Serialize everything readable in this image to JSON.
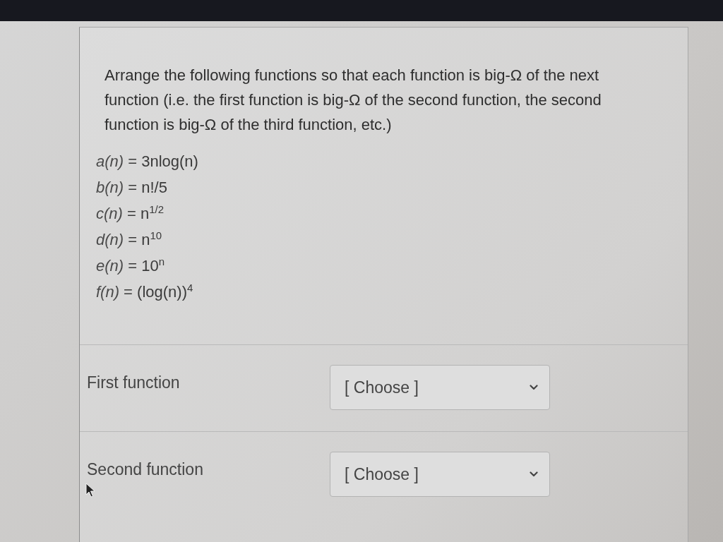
{
  "question": {
    "prompt": "Arrange the following functions so that each function is big-Ω of the next function (i.e. the first function is big-Ω of the second function, the second function is big-Ω of the third function, etc.)",
    "functions": [
      "*a(n)* = 3nlog(n)",
      "*b(n)* = n!/5",
      "*c(n)* = n$^{1/2}$",
      "*d(n)* = n$^{10}$",
      "*e(n)* = 10$^{n}$",
      "*f(n)* = (log(n))$^{4}$"
    ]
  },
  "answers": [
    {
      "label": "First function",
      "value": "[ Choose ]"
    },
    {
      "label": "Second function",
      "value": "[ Choose ]"
    }
  ]
}
